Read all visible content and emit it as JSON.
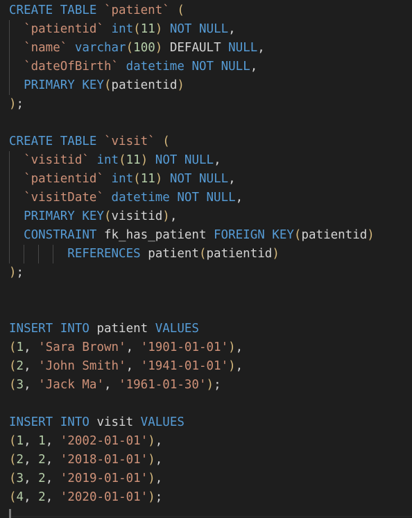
{
  "editor": {
    "language": "sql",
    "background_color": "#1e1e1e",
    "default_text_color": "#d4d4d4",
    "indent_guide_color": "#484848",
    "theme_colors": {
      "keyword": "#569cd6",
      "string": "#ce9178",
      "number": "#b5cea8",
      "bracket": "#d7ba7d",
      "identifier": "#d4d4d4"
    },
    "line_height_px": 27,
    "font_size_px": 17.5
  },
  "code": {
    "lines": [
      {
        "n": 1,
        "guides": 0,
        "text": "CREATE TABLE `patient` (",
        "tokens": [
          {
            "t": "CREATE TABLE ",
            "c": "kw"
          },
          {
            "t": "`patient`",
            "c": "str"
          },
          {
            "t": " (",
            "c": "pn"
          }
        ]
      },
      {
        "n": 2,
        "guides": 1,
        "text": "  `patientid` int(11) NOT NULL,",
        "tokens": [
          {
            "t": "  ",
            "c": "id"
          },
          {
            "t": "`patientid`",
            "c": "str"
          },
          {
            "t": " ",
            "c": "id"
          },
          {
            "t": "int",
            "c": "kw"
          },
          {
            "t": "(",
            "c": "pn"
          },
          {
            "t": "11",
            "c": "num"
          },
          {
            "t": ")",
            "c": "pn"
          },
          {
            "t": " ",
            "c": "id"
          },
          {
            "t": "NOT NULL",
            "c": "kw"
          },
          {
            "t": ",",
            "c": "id"
          }
        ]
      },
      {
        "n": 3,
        "guides": 1,
        "text": "  `name` varchar(100) DEFAULT NULL,",
        "tokens": [
          {
            "t": "  ",
            "c": "id"
          },
          {
            "t": "`name`",
            "c": "str"
          },
          {
            "t": " ",
            "c": "id"
          },
          {
            "t": "varchar",
            "c": "kw"
          },
          {
            "t": "(",
            "c": "pn"
          },
          {
            "t": "100",
            "c": "num"
          },
          {
            "t": ")",
            "c": "pn"
          },
          {
            "t": " DEFAULT ",
            "c": "id"
          },
          {
            "t": "NULL",
            "c": "kw"
          },
          {
            "t": ",",
            "c": "id"
          }
        ]
      },
      {
        "n": 4,
        "guides": 1,
        "text": "  `dateOfBirth` datetime NOT NULL,",
        "tokens": [
          {
            "t": "  ",
            "c": "id"
          },
          {
            "t": "`dateOfBirth`",
            "c": "str"
          },
          {
            "t": " ",
            "c": "id"
          },
          {
            "t": "datetime",
            "c": "kw"
          },
          {
            "t": " ",
            "c": "id"
          },
          {
            "t": "NOT NULL",
            "c": "kw"
          },
          {
            "t": ",",
            "c": "id"
          }
        ]
      },
      {
        "n": 5,
        "guides": 1,
        "text": "  PRIMARY KEY(patientid)",
        "tokens": [
          {
            "t": "  ",
            "c": "id"
          },
          {
            "t": "PRIMARY KEY",
            "c": "kw"
          },
          {
            "t": "(",
            "c": "pn"
          },
          {
            "t": "patientid",
            "c": "id"
          },
          {
            "t": ")",
            "c": "pn"
          }
        ]
      },
      {
        "n": 6,
        "guides": 0,
        "text": ");",
        "tokens": [
          {
            "t": ")",
            "c": "pn"
          },
          {
            "t": ";",
            "c": "id"
          }
        ]
      },
      {
        "n": 7,
        "guides": 0,
        "text": "",
        "tokens": []
      },
      {
        "n": 8,
        "guides": 0,
        "text": "CREATE TABLE `visit` (",
        "tokens": [
          {
            "t": "CREATE TABLE ",
            "c": "kw"
          },
          {
            "t": "`visit`",
            "c": "str"
          },
          {
            "t": " (",
            "c": "pn"
          }
        ]
      },
      {
        "n": 9,
        "guides": 1,
        "text": "  `visitid` int(11) NOT NULL,",
        "tokens": [
          {
            "t": "  ",
            "c": "id"
          },
          {
            "t": "`visitid`",
            "c": "str"
          },
          {
            "t": " ",
            "c": "id"
          },
          {
            "t": "int",
            "c": "kw"
          },
          {
            "t": "(",
            "c": "pn"
          },
          {
            "t": "11",
            "c": "num"
          },
          {
            "t": ")",
            "c": "pn"
          },
          {
            "t": " ",
            "c": "id"
          },
          {
            "t": "NOT NULL",
            "c": "kw"
          },
          {
            "t": ",",
            "c": "id"
          }
        ]
      },
      {
        "n": 10,
        "guides": 1,
        "text": "  `patientid` int(11) NOT NULL,",
        "tokens": [
          {
            "t": "  ",
            "c": "id"
          },
          {
            "t": "`patientid`",
            "c": "str"
          },
          {
            "t": " ",
            "c": "id"
          },
          {
            "t": "int",
            "c": "kw"
          },
          {
            "t": "(",
            "c": "pn"
          },
          {
            "t": "11",
            "c": "num"
          },
          {
            "t": ")",
            "c": "pn"
          },
          {
            "t": " ",
            "c": "id"
          },
          {
            "t": "NOT NULL",
            "c": "kw"
          },
          {
            "t": ",",
            "c": "id"
          }
        ]
      },
      {
        "n": 11,
        "guides": 1,
        "text": "  `visitDate` datetime NOT NULL,",
        "tokens": [
          {
            "t": "  ",
            "c": "id"
          },
          {
            "t": "`visitDate`",
            "c": "str"
          },
          {
            "t": " ",
            "c": "id"
          },
          {
            "t": "datetime",
            "c": "kw"
          },
          {
            "t": " ",
            "c": "id"
          },
          {
            "t": "NOT NULL",
            "c": "kw"
          },
          {
            "t": ",",
            "c": "id"
          }
        ]
      },
      {
        "n": 12,
        "guides": 1,
        "text": "  PRIMARY KEY(visitid),",
        "tokens": [
          {
            "t": "  ",
            "c": "id"
          },
          {
            "t": "PRIMARY KEY",
            "c": "kw"
          },
          {
            "t": "(",
            "c": "pn"
          },
          {
            "t": "visitid",
            "c": "id"
          },
          {
            "t": ")",
            "c": "pn"
          },
          {
            "t": ",",
            "c": "id"
          }
        ]
      },
      {
        "n": 13,
        "guides": 1,
        "text": "  CONSTRAINT fk_has_patient FOREIGN KEY(patientid)",
        "tokens": [
          {
            "t": "  ",
            "c": "id"
          },
          {
            "t": "CONSTRAINT",
            "c": "kw"
          },
          {
            "t": " fk_has_patient ",
            "c": "id"
          },
          {
            "t": "FOREIGN KEY",
            "c": "kw"
          },
          {
            "t": "(",
            "c": "pn"
          },
          {
            "t": "patientid",
            "c": "id"
          },
          {
            "t": ")",
            "c": "pn"
          }
        ]
      },
      {
        "n": 14,
        "guides": 4,
        "text": "        REFERENCES patient(patientid)",
        "tokens": [
          {
            "t": "        ",
            "c": "id"
          },
          {
            "t": "REFERENCES",
            "c": "kw"
          },
          {
            "t": " patient",
            "c": "id"
          },
          {
            "t": "(",
            "c": "pn"
          },
          {
            "t": "patientid",
            "c": "id"
          },
          {
            "t": ")",
            "c": "pn"
          }
        ]
      },
      {
        "n": 15,
        "guides": 0,
        "text": ");",
        "tokens": [
          {
            "t": ")",
            "c": "pn"
          },
          {
            "t": ";",
            "c": "id"
          }
        ]
      },
      {
        "n": 16,
        "guides": 0,
        "text": "",
        "tokens": []
      },
      {
        "n": 17,
        "guides": 0,
        "text": "",
        "tokens": []
      },
      {
        "n": 18,
        "guides": 0,
        "text": "INSERT INTO patient VALUES",
        "tokens": [
          {
            "t": "INSERT INTO",
            "c": "kw"
          },
          {
            "t": " patient ",
            "c": "id"
          },
          {
            "t": "VALUES",
            "c": "kw"
          }
        ]
      },
      {
        "n": 19,
        "guides": 0,
        "text": "(1, 'Sara Brown', '1901-01-01'),",
        "tokens": [
          {
            "t": "(",
            "c": "pn"
          },
          {
            "t": "1",
            "c": "num"
          },
          {
            "t": ", ",
            "c": "id"
          },
          {
            "t": "'Sara Brown'",
            "c": "str"
          },
          {
            "t": ", ",
            "c": "id"
          },
          {
            "t": "'1901-01-01'",
            "c": "str"
          },
          {
            "t": ")",
            "c": "pn"
          },
          {
            "t": ",",
            "c": "id"
          }
        ]
      },
      {
        "n": 20,
        "guides": 0,
        "text": "(2, 'John Smith', '1941-01-01'),",
        "tokens": [
          {
            "t": "(",
            "c": "pn"
          },
          {
            "t": "2",
            "c": "num"
          },
          {
            "t": ", ",
            "c": "id"
          },
          {
            "t": "'John Smith'",
            "c": "str"
          },
          {
            "t": ", ",
            "c": "id"
          },
          {
            "t": "'1941-01-01'",
            "c": "str"
          },
          {
            "t": ")",
            "c": "pn"
          },
          {
            "t": ",",
            "c": "id"
          }
        ]
      },
      {
        "n": 21,
        "guides": 0,
        "text": "(3, 'Jack Ma', '1961-01-30');",
        "tokens": [
          {
            "t": "(",
            "c": "pn"
          },
          {
            "t": "3",
            "c": "num"
          },
          {
            "t": ", ",
            "c": "id"
          },
          {
            "t": "'Jack Ma'",
            "c": "str"
          },
          {
            "t": ", ",
            "c": "id"
          },
          {
            "t": "'1961-01-30'",
            "c": "str"
          },
          {
            "t": ")",
            "c": "pn"
          },
          {
            "t": ";",
            "c": "id"
          }
        ]
      },
      {
        "n": 22,
        "guides": 0,
        "text": "",
        "tokens": []
      },
      {
        "n": 23,
        "guides": 0,
        "text": "INSERT INTO visit VALUES",
        "tokens": [
          {
            "t": "INSERT INTO",
            "c": "kw"
          },
          {
            "t": " visit ",
            "c": "id"
          },
          {
            "t": "VALUES",
            "c": "kw"
          }
        ]
      },
      {
        "n": 24,
        "guides": 0,
        "text": "(1, 1, '2002-01-01'),",
        "tokens": [
          {
            "t": "(",
            "c": "pn"
          },
          {
            "t": "1",
            "c": "num"
          },
          {
            "t": ", ",
            "c": "id"
          },
          {
            "t": "1",
            "c": "num"
          },
          {
            "t": ", ",
            "c": "id"
          },
          {
            "t": "'2002-01-01'",
            "c": "str"
          },
          {
            "t": ")",
            "c": "pn"
          },
          {
            "t": ",",
            "c": "id"
          }
        ]
      },
      {
        "n": 25,
        "guides": 0,
        "text": "(2, 2, '2018-01-01'),",
        "tokens": [
          {
            "t": "(",
            "c": "pn"
          },
          {
            "t": "2",
            "c": "num"
          },
          {
            "t": ", ",
            "c": "id"
          },
          {
            "t": "2",
            "c": "num"
          },
          {
            "t": ", ",
            "c": "id"
          },
          {
            "t": "'2018-01-01'",
            "c": "str"
          },
          {
            "t": ")",
            "c": "pn"
          },
          {
            "t": ",",
            "c": "id"
          }
        ]
      },
      {
        "n": 26,
        "guides": 0,
        "text": "(3, 2, '2019-01-01'),",
        "tokens": [
          {
            "t": "(",
            "c": "pn"
          },
          {
            "t": "3",
            "c": "num"
          },
          {
            "t": ", ",
            "c": "id"
          },
          {
            "t": "2",
            "c": "num"
          },
          {
            "t": ", ",
            "c": "id"
          },
          {
            "t": "'2019-01-01'",
            "c": "str"
          },
          {
            "t": ")",
            "c": "pn"
          },
          {
            "t": ",",
            "c": "id"
          }
        ]
      },
      {
        "n": 27,
        "guides": 0,
        "text": "(4, 2, '2020-01-01');",
        "tokens": [
          {
            "t": "(",
            "c": "pn"
          },
          {
            "t": "4",
            "c": "num"
          },
          {
            "t": ", ",
            "c": "id"
          },
          {
            "t": "2",
            "c": "num"
          },
          {
            "t": ", ",
            "c": "id"
          },
          {
            "t": "'2020-01-01'",
            "c": "str"
          },
          {
            "t": ")",
            "c": "pn"
          },
          {
            "t": ";",
            "c": "id"
          }
        ]
      }
    ]
  }
}
